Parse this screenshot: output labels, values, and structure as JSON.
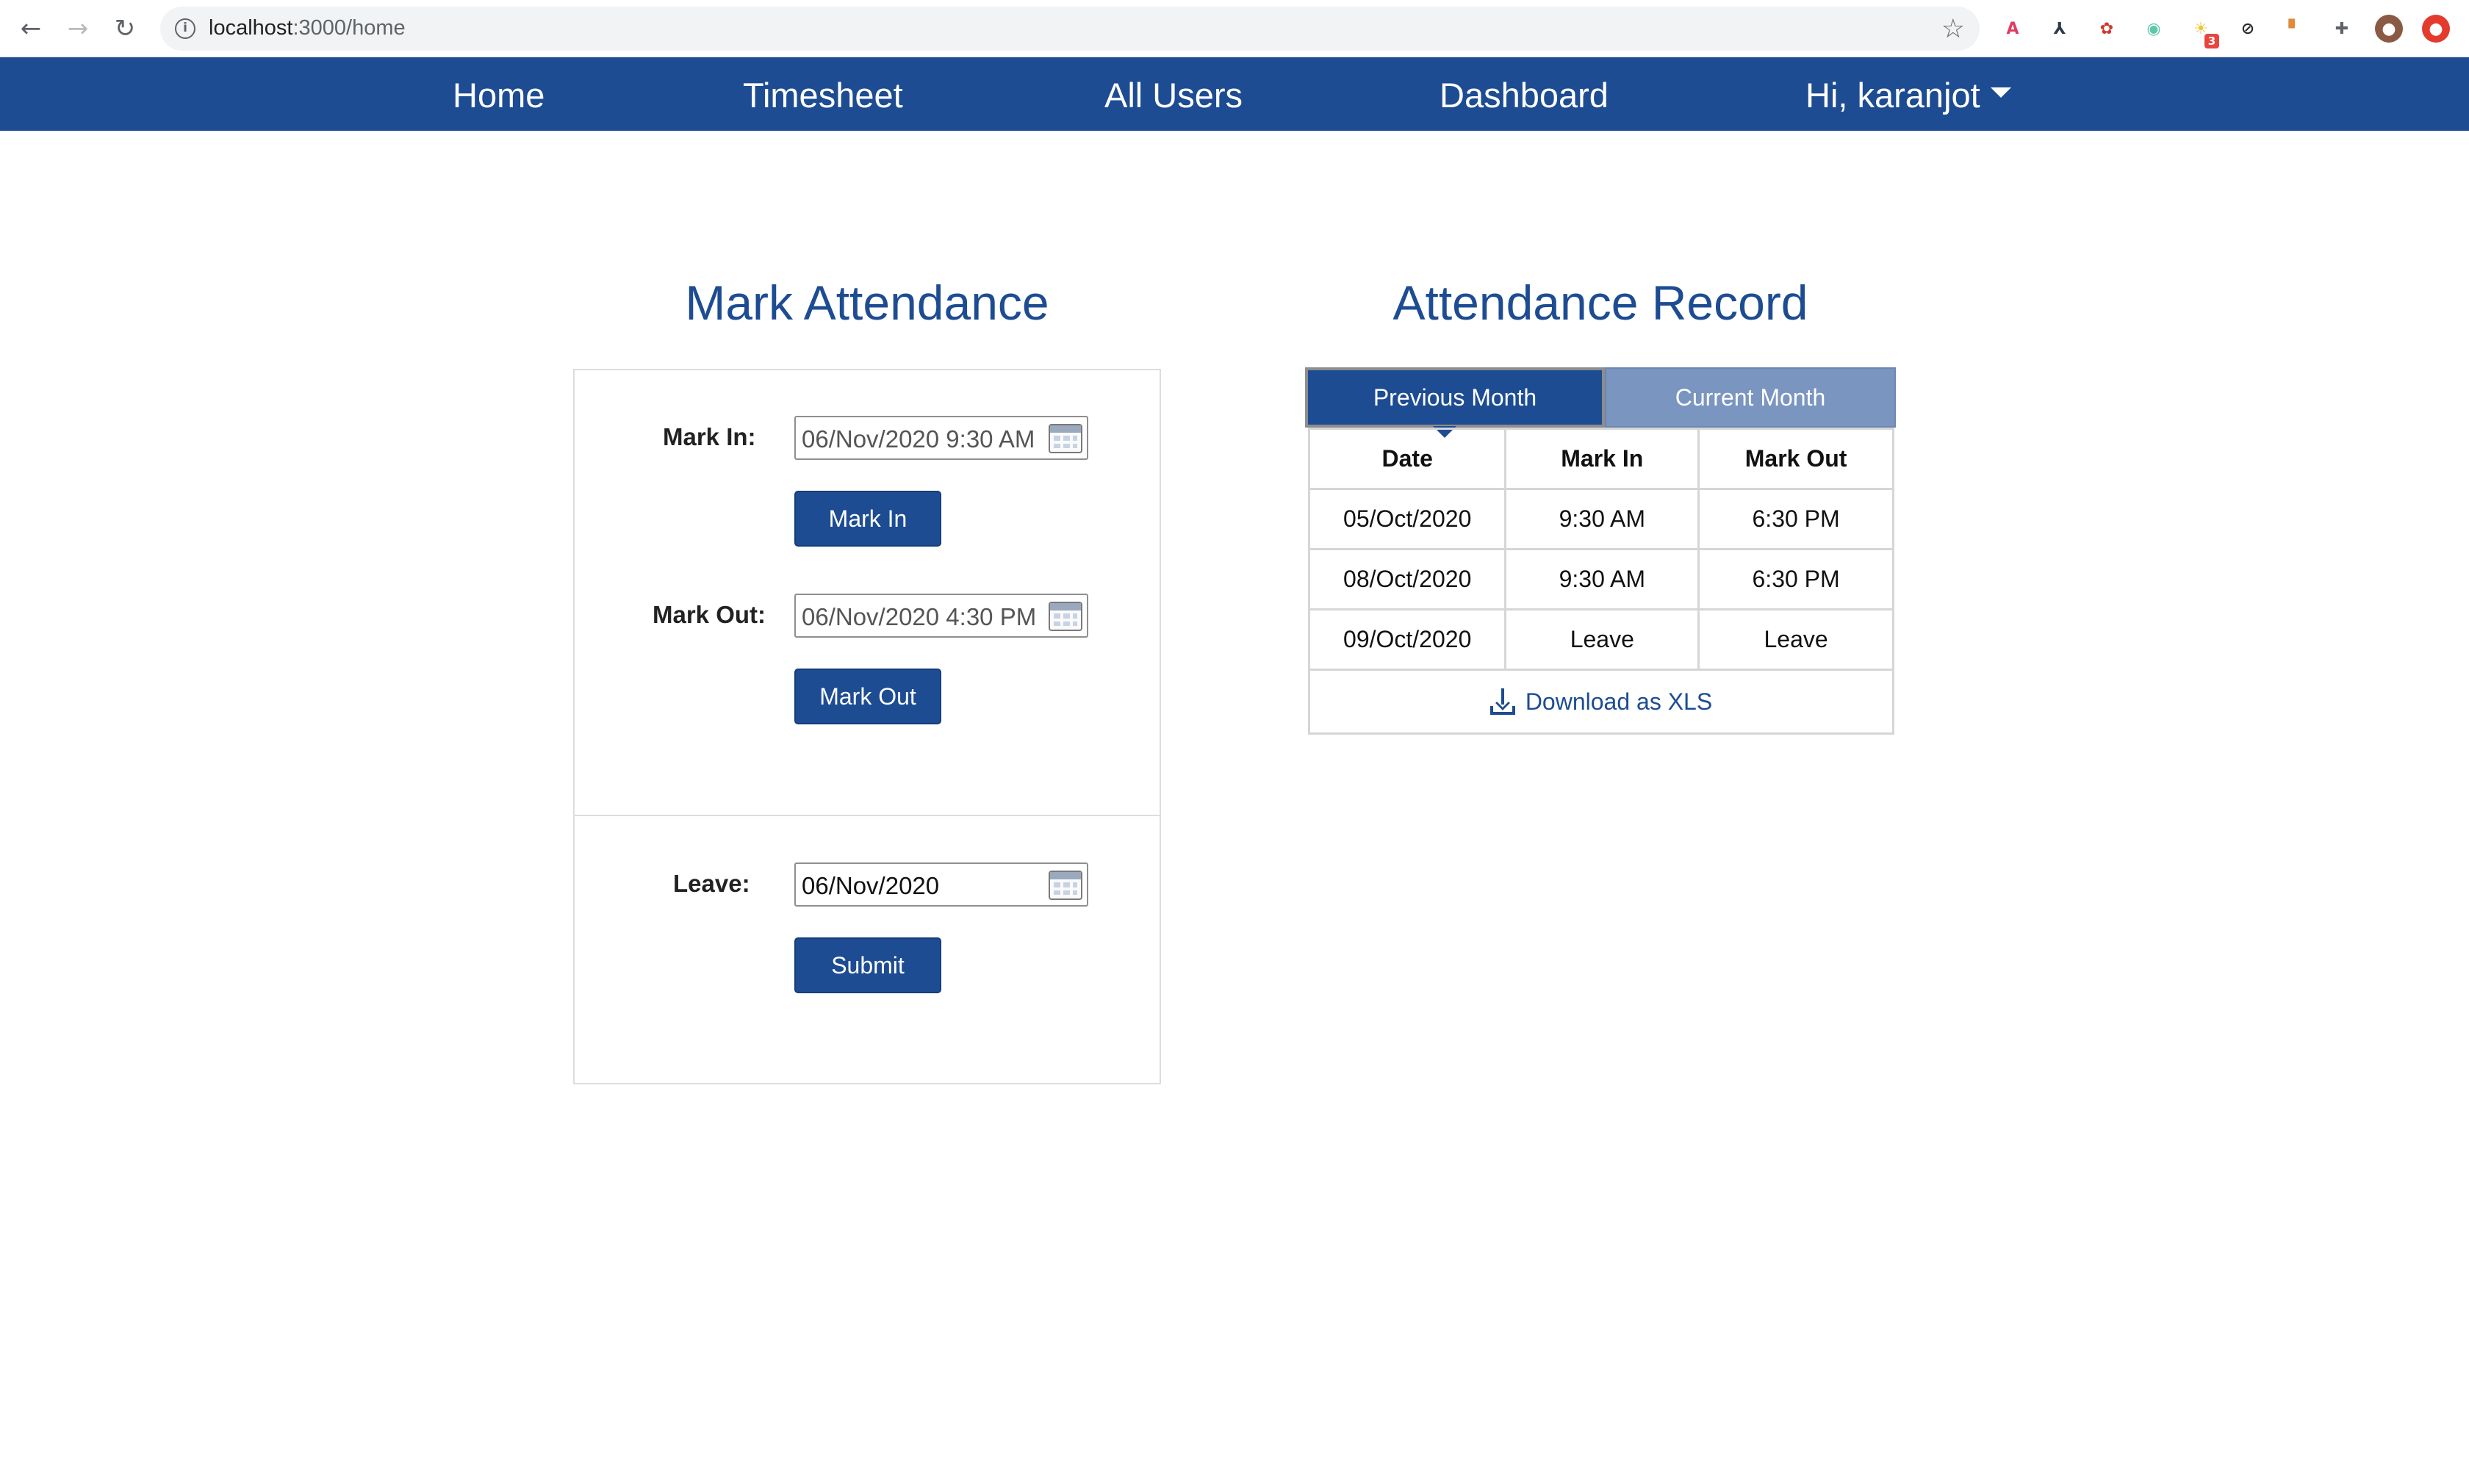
{
  "browser": {
    "url_host": "localhost",
    "url_path": ":3000/home",
    "icons": {
      "back": "arrow-left-icon",
      "forward": "arrow-right-icon",
      "reload": "reload-icon",
      "info": "info-icon",
      "bookmark": "star-icon"
    },
    "extensions": [
      {
        "name": "angular-extension-icon",
        "glyph": "A",
        "color": "#dd3d61"
      },
      {
        "name": "graph-extension-icon",
        "glyph": "⅄",
        "color": "#2d3a4a"
      },
      {
        "name": "pdf-extension-icon",
        "glyph": "✿",
        "color": "#d2362e"
      },
      {
        "name": "color-extension-icon",
        "glyph": "◉",
        "color": "#5cc8a8"
      },
      {
        "name": "lightbulb-extension-icon",
        "glyph": "☀",
        "color": "#f2c33b",
        "badge": "3"
      },
      {
        "name": "zoom-extension-icon",
        "glyph": "⊘",
        "color": "#2b2b2b"
      },
      {
        "name": "comment-extension-icon",
        "glyph": "▘",
        "color": "#e08a3c"
      },
      {
        "name": "puzzle-extension-icon",
        "glyph": "✚",
        "color": "#5f6368"
      },
      {
        "name": "profile-avatar-icon",
        "glyph": "●",
        "color": "#8a5a44"
      },
      {
        "name": "update-extension-icon",
        "glyph": "●",
        "color": "#e33b2e"
      }
    ]
  },
  "nav": {
    "home": "Home",
    "timesheet": "Timesheet",
    "all_users": "All Users",
    "dashboard": "Dashboard",
    "user_menu": "Hi, karanjot"
  },
  "mark_attendance": {
    "title": "Mark Attendance",
    "mark_in_label": "Mark In:",
    "mark_in_value": "06/Nov/2020 9:30 AM",
    "mark_in_button": "Mark In",
    "mark_out_label": "Mark Out:",
    "mark_out_value": "06/Nov/2020 4:30 PM",
    "mark_out_button": "Mark Out",
    "leave_label": "Leave:",
    "leave_value": "06/Nov/2020",
    "submit_button": "Submit"
  },
  "attendance_record": {
    "title": "Attendance Record",
    "tabs": [
      {
        "label": "Previous Month",
        "active": true
      },
      {
        "label": "Current Month",
        "active": false
      }
    ],
    "columns": [
      "Date",
      "Mark In",
      "Mark Out"
    ],
    "rows": [
      [
        "05/Oct/2020",
        "9:30 AM",
        "6:30 PM"
      ],
      [
        "08/Oct/2020",
        "9:30 AM",
        "6:30 PM"
      ],
      [
        "09/Oct/2020",
        "Leave",
        "Leave"
      ]
    ],
    "download_label": "Download as XLS"
  },
  "colors": {
    "brand": "#1d4c92",
    "inactive_tab": "#7a95bf"
  }
}
